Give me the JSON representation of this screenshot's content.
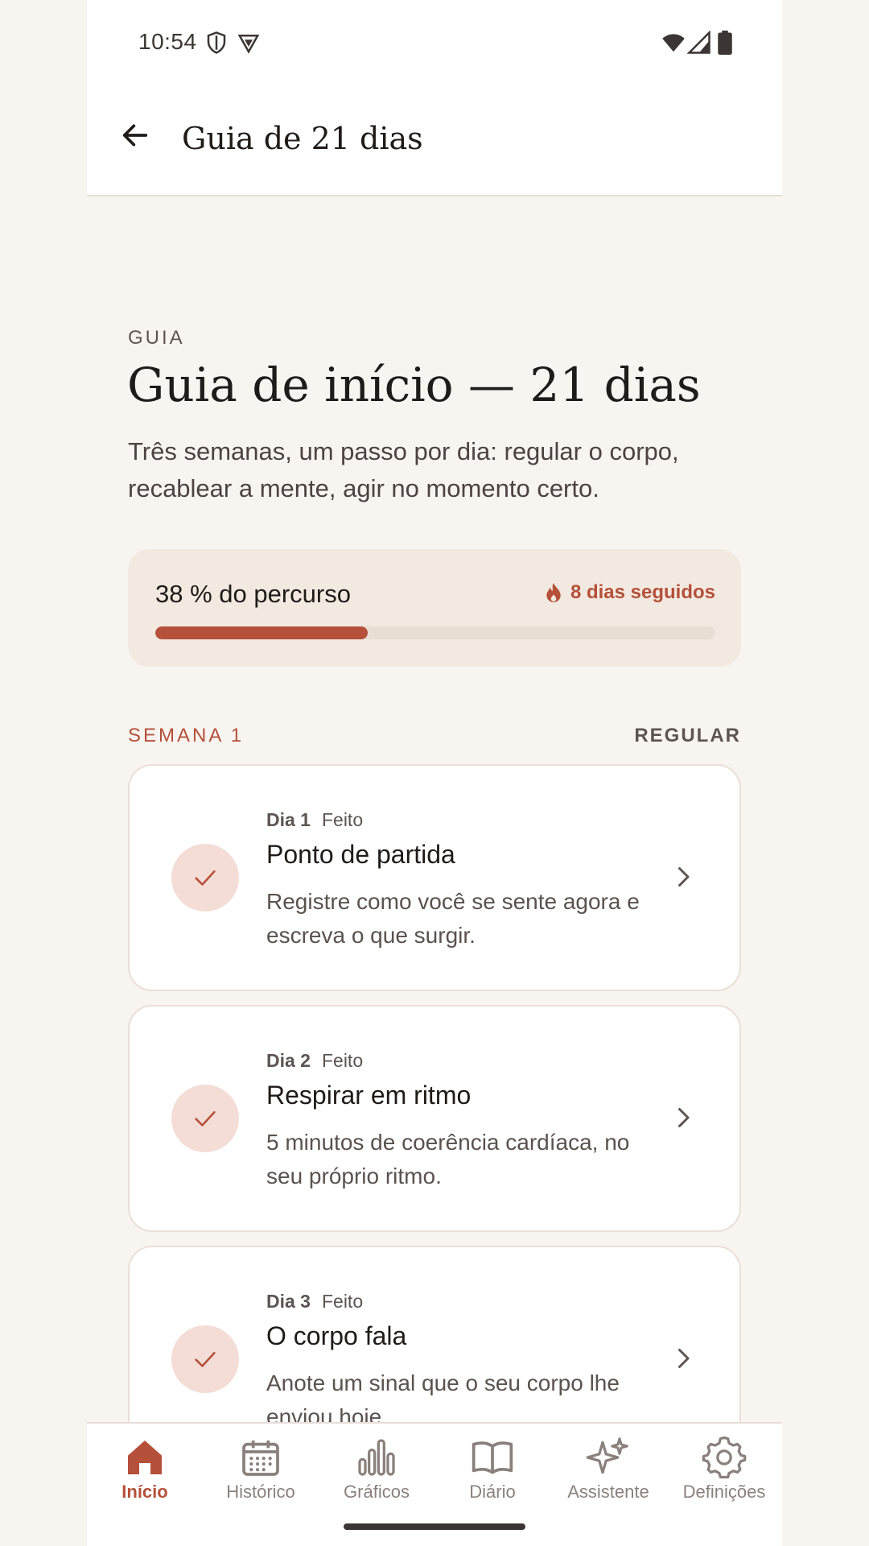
{
  "status_bar": {
    "time": "10:54"
  },
  "app_bar": {
    "title": "Guia de 21 dias",
    "back_icon": "arrow-left-icon"
  },
  "intro": {
    "eyebrow": "GUIA",
    "headline": "Guia de início — 21 dias",
    "subtitle": "Três semanas, um passo por dia: regular o corpo, recablear a mente, agir no momento certo."
  },
  "progress": {
    "label": "38 % do percurso",
    "percent": 38,
    "streak_label": "8 dias seguidos",
    "streak_icon": "flame-icon"
  },
  "week": {
    "label": "SEMANA 1",
    "theme": "REGULAR"
  },
  "days": [
    {
      "num": "Dia 1",
      "status": "Feito",
      "title": "Ponto de partida",
      "desc": "Registre como você se sente agora e escreva o que surgir."
    },
    {
      "num": "Dia 2",
      "status": "Feito",
      "title": "Respirar em ritmo",
      "desc": "5 minutos de coerência cardíaca, no seu próprio ritmo."
    },
    {
      "num": "Dia 3",
      "status": "Feito",
      "title": "O corpo fala",
      "desc": "Anote um sinal que o seu corpo lhe enviou hoje."
    }
  ],
  "nav": [
    {
      "label": "Início",
      "icon": "home-icon",
      "active": true
    },
    {
      "label": "Histórico",
      "icon": "calendar-icon"
    },
    {
      "label": "Gráficos",
      "icon": "bar-chart-icon"
    },
    {
      "label": "Diário",
      "icon": "book-icon"
    },
    {
      "label": "Assistente",
      "icon": "sparkles-icon"
    },
    {
      "label": "Definições",
      "icon": "gear-icon"
    }
  ],
  "colors": {
    "accent": "#b5503a",
    "background": "#f8f5f1",
    "card": "#ffffff",
    "progress_bg": "#f2e9e0"
  }
}
